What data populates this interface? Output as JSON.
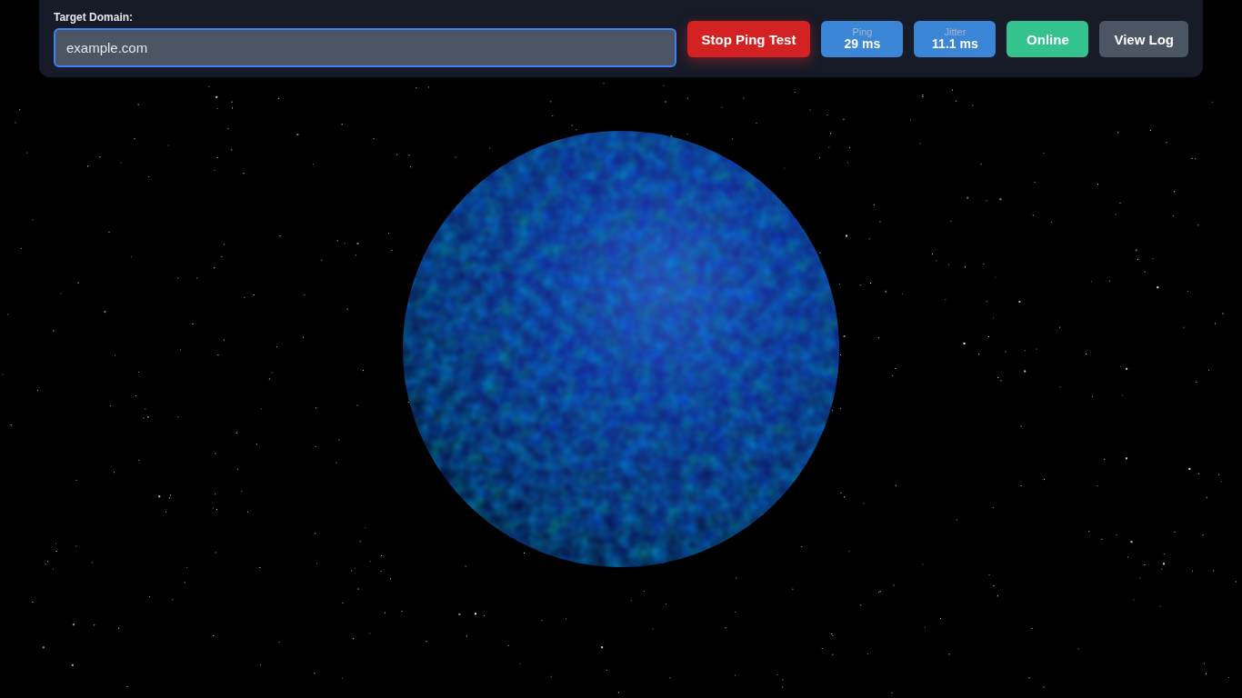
{
  "domain_field": {
    "label": "Target Domain:",
    "value": "example.com",
    "focused": true
  },
  "controls": [
    {
      "kind": "action",
      "color": "#d42121",
      "label": "Stop Ping Test"
    },
    {
      "kind": "metric",
      "label": "Ping",
      "value": "29 ms"
    },
    {
      "kind": "metric",
      "label": "Jitter",
      "value": "11.1 ms"
    },
    {
      "kind": "status",
      "color": "#34c28e",
      "label": "Online"
    },
    {
      "kind": "action",
      "color": "#4b5563",
      "label": "View Log"
    }
  ]
}
